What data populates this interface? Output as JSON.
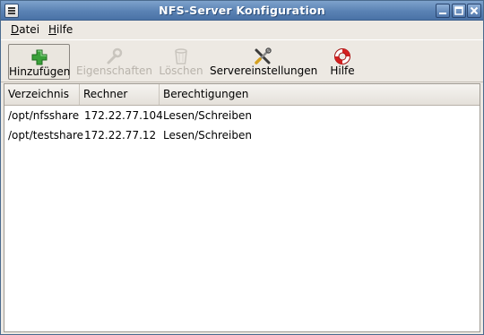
{
  "window": {
    "title": "NFS-Server Konfiguration",
    "controls": [
      "minimize",
      "maximize",
      "close"
    ]
  },
  "menubar": {
    "items": [
      {
        "label": "Datei",
        "mnemonic": "D",
        "rest": "atei"
      },
      {
        "label": "Hilfe",
        "mnemonic": "H",
        "rest": "ilfe"
      }
    ]
  },
  "toolbar": {
    "buttons": [
      {
        "label": "Hinzufügen",
        "icon": "add-icon",
        "enabled": true
      },
      {
        "label": "Eigenschaften",
        "icon": "wrench-icon",
        "enabled": false
      },
      {
        "label": "Löschen",
        "icon": "trash-icon",
        "enabled": false
      },
      {
        "label": "Servereinstellungen",
        "icon": "tools-icon",
        "enabled": true
      },
      {
        "label": "Hilfe",
        "icon": "lifebuoy-icon",
        "enabled": true
      }
    ]
  },
  "table": {
    "columns": [
      "Verzeichnis",
      "Rechner",
      "Berechtigungen"
    ],
    "rows": [
      [
        "/opt/nfsshare",
        "172.22.77.104",
        "Lesen/Schreiben"
      ],
      [
        "/opt/testshare",
        "172.22.77.12",
        "Lesen/Schreiben"
      ]
    ]
  },
  "colors": {
    "titlebar": "#5a82b4",
    "window_bg": "#ede9e3",
    "disabled_text": "#b8b3ab"
  }
}
